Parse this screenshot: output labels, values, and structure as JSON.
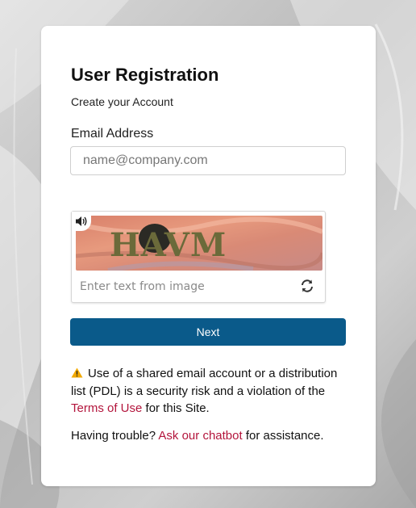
{
  "page": {
    "title": "User Registration",
    "subtitle": "Create your Account"
  },
  "email": {
    "label": "Email Address",
    "placeholder": "name@company.com",
    "value": ""
  },
  "captcha": {
    "image_text": "HAVM",
    "placeholder": "Enter text from image",
    "audio_icon": "speaker-icon",
    "refresh_icon": "refresh-icon"
  },
  "actions": {
    "next_label": "Next"
  },
  "notice": {
    "icon": "warning-icon",
    "text_before": "Use of a shared email account or a distribution list (PDL) is a security risk and a violation of the",
    "link_text": "Terms of Use",
    "text_after": "for this Site."
  },
  "help": {
    "text_before": "Having trouble?",
    "link_text": "Ask our chatbot",
    "text_after": "for assistance."
  },
  "colors": {
    "primary_button": "#0a5a8a",
    "link": "#b3153c",
    "warning": "#f2a900"
  }
}
